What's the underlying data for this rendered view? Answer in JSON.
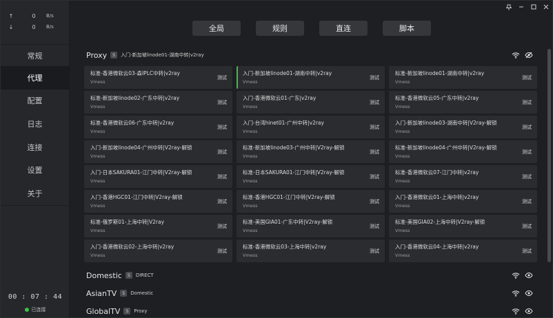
{
  "window_controls": [
    "pin-icon",
    "minimize-icon",
    "maximize-icon",
    "close-icon"
  ],
  "speed": {
    "up": {
      "arrow": "↑",
      "value": "0",
      "unit": "B/s"
    },
    "down": {
      "arrow": "↓",
      "value": "0",
      "unit": "B/s"
    }
  },
  "nav": {
    "items": [
      {
        "label": "常规"
      },
      {
        "label": "代理",
        "active": true
      },
      {
        "label": "配置"
      },
      {
        "label": "日志"
      },
      {
        "label": "连接"
      },
      {
        "label": "设置"
      },
      {
        "label": "关于"
      }
    ]
  },
  "timer": "00 : 07 : 44",
  "status_text": "已连接",
  "modes": [
    {
      "label": "全局"
    },
    {
      "label": "规则"
    },
    {
      "label": "直连"
    },
    {
      "label": "脚本"
    }
  ],
  "proxy_group": {
    "name": "Proxy",
    "badge": "S",
    "selected": "入门-新加坡linode01-湖南中转|v2ray",
    "test_label": "测试",
    "nodes": [
      {
        "name": "标准-香港微软云03-森IPLC中转|v2ray",
        "type": "Vmess"
      },
      {
        "name": "入门-新加坡linode01-湖南中转|v2ray",
        "type": "Vmess",
        "selected": true
      },
      {
        "name": "标准-新加坡linode01-湖南中转|v2ray",
        "type": "Vmess"
      },
      {
        "name": "标准-新加坡linode02-广东中转|v2ray",
        "type": "Vmess"
      },
      {
        "name": "入门-香港微软云01-广东|v2ray",
        "type": "Vmess"
      },
      {
        "name": "标准-香港微软云05-广东中转|v2ray",
        "type": "Vmess"
      },
      {
        "name": "标准-香港微软云06-广东中转|v2ray",
        "type": "Vmess"
      },
      {
        "name": "入门-台湾hinet01-广州中转|v2ray",
        "type": "Vmess"
      },
      {
        "name": "入门-新加坡linode03-湖南中转|V2ray-解锁",
        "type": "Vmess"
      },
      {
        "name": "入门-新加坡linode04-广州中转|V2ray-解锁",
        "type": "Vmess"
      },
      {
        "name": "标准-新加坡linode03-广州中转|V2ray-解锁",
        "type": "Vmess"
      },
      {
        "name": "标准-新加坡linode04-广州中转|V2ray-解锁",
        "type": "Vmess"
      },
      {
        "name": "入门-日本SAKURA01-江门中转|V2ray-解锁",
        "type": "Vmess"
      },
      {
        "name": "标准-日本SAKURA01-江门中转|V2ray-解锁",
        "type": "Vmess"
      },
      {
        "name": "标准-香港微软云07-江门中转|v2ray",
        "type": "Vmess"
      },
      {
        "name": "入门-香港HGC01-江门中转|V2ray-解锁",
        "type": "Vmess"
      },
      {
        "name": "标准-香港HGC01-江门中转|V2ray-解锁",
        "type": "Vmess"
      },
      {
        "name": "入门-香港微软云01-上海中转|v2ray",
        "type": "Vmess"
      },
      {
        "name": "标准-俄罗斯01-上海中转|V2ray",
        "type": "Vmess"
      },
      {
        "name": "标准-美国GIA01-广东中转|V2ray-解锁",
        "type": "Vmess"
      },
      {
        "name": "标准-美国GIA02-上海中转|V2ray-解锁",
        "type": "Vmess"
      },
      {
        "name": "入门-香港微软云02-上海中转|v2ray",
        "type": "Vmess"
      },
      {
        "name": "标准-香港微软云03-上海中转|v2ray",
        "type": "Vmess"
      },
      {
        "name": "入门-香港微软云04-上海中转|v2ray",
        "type": "Vmess"
      }
    ]
  },
  "other_groups": [
    {
      "name": "Domestic",
      "badge": "S",
      "selected": "DIRECT"
    },
    {
      "name": "AsianTV",
      "badge": "S",
      "selected": "Domestic"
    },
    {
      "name": "GlobalTV",
      "badge": "S",
      "selected": "Proxy"
    }
  ],
  "colors": {
    "accent": "#3fbf4a",
    "background": "#1e1f22",
    "card": "#2b2c30"
  }
}
